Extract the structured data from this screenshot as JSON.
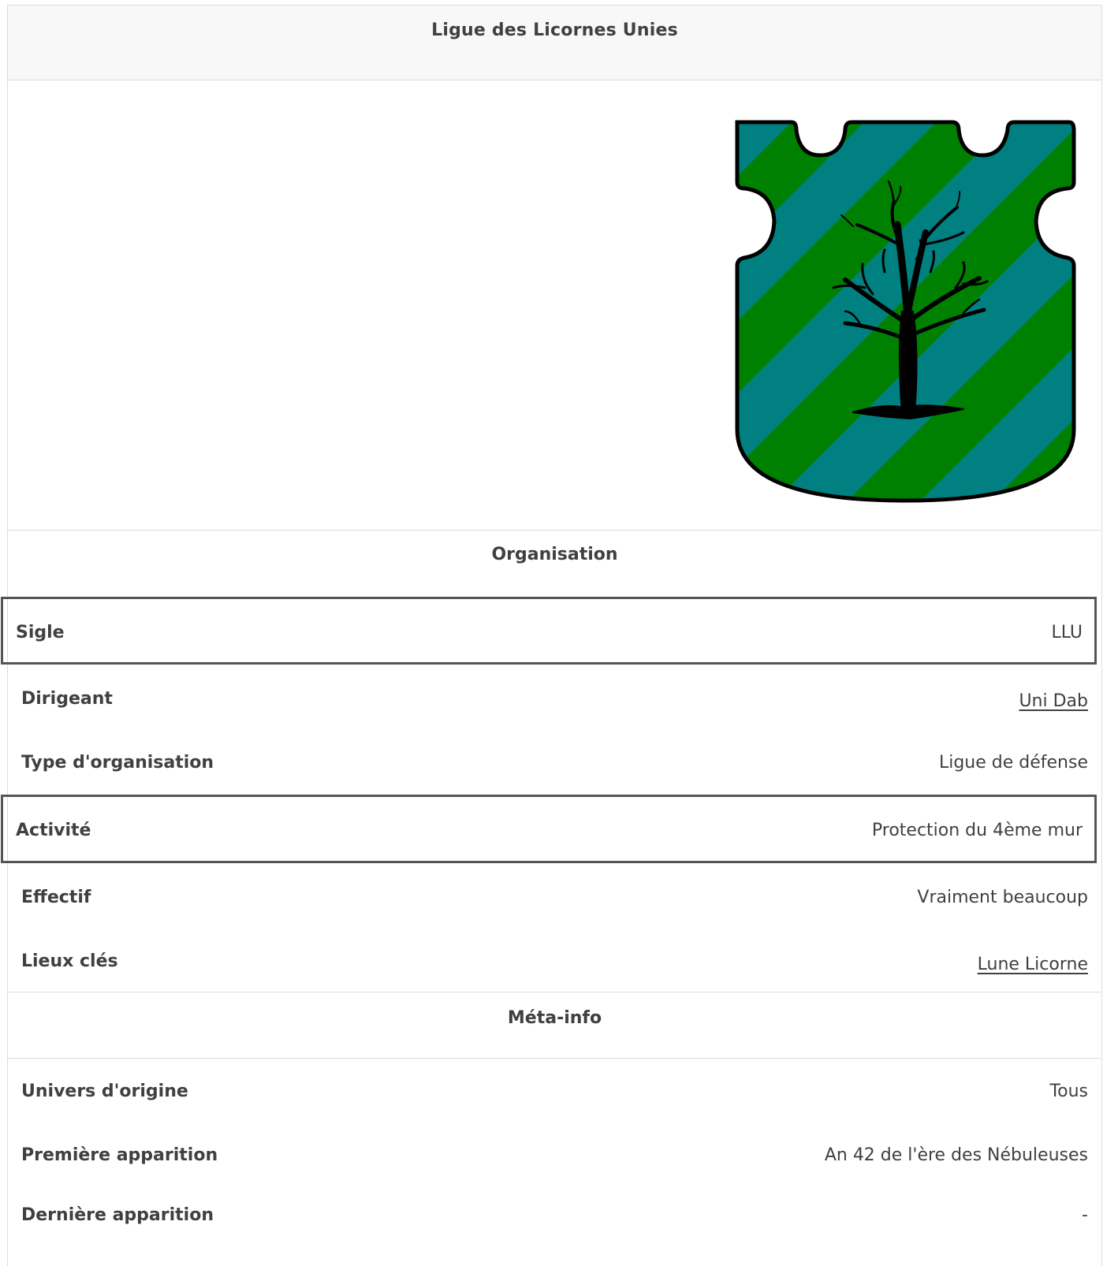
{
  "title": "Ligue des Licornes Unies",
  "crest": {
    "icon": "shield-crest-tree-icon",
    "colors": {
      "stripe_green": "#008000",
      "stripe_teal": "#008080",
      "tree": "#000000"
    }
  },
  "sections": {
    "organisation": "Organisation",
    "meta": "Méta-info"
  },
  "rows": {
    "sigle": {
      "label": "Sigle",
      "value": "LLU"
    },
    "dirigeant": {
      "label": "Dirigeant",
      "value": "Uni Dab"
    },
    "type": {
      "label": "Type d'organisation",
      "value": "Ligue de défense"
    },
    "activite": {
      "label": "Activité",
      "value": "Protection du 4ème mur"
    },
    "effectif": {
      "label": "Effectif",
      "value": "Vraiment beaucoup"
    },
    "lieux": {
      "label": "Lieux clés",
      "value": "Lune Licorne"
    },
    "univers": {
      "label": "Univers d'origine",
      "value": "Tous"
    },
    "premiere": {
      "label": "Première apparition",
      "value": "An 42 de l'ère des Nébuleuses"
    },
    "derniere": {
      "label": "Dernière apparition",
      "value": "-"
    }
  },
  "colors": {
    "link": "#2f6fb0",
    "text": "#404040",
    "header_bg": "#f8f8f8"
  }
}
